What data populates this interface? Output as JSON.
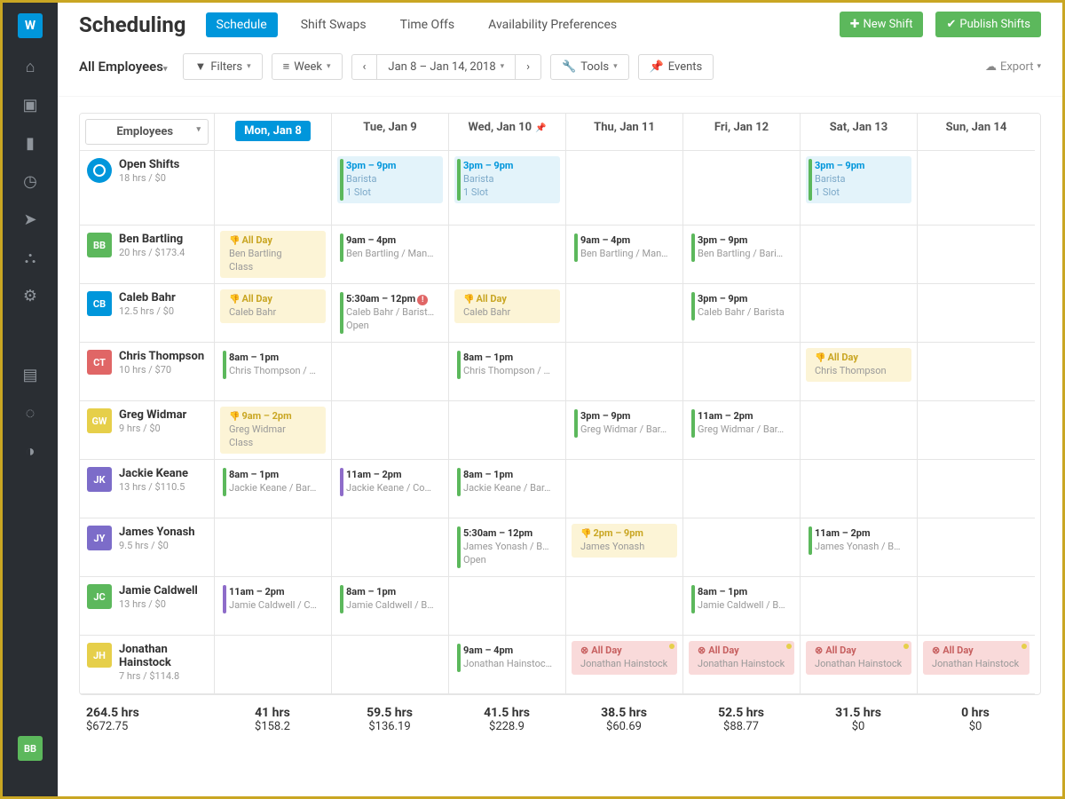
{
  "sidebar": {
    "logo": "W",
    "user": "BB"
  },
  "header": {
    "title": "Scheduling",
    "tabs": [
      "Schedule",
      "Shift Swaps",
      "Time Offs",
      "Availability Preferences"
    ],
    "new_shift": "New Shift",
    "publish": "Publish Shifts"
  },
  "toolbar": {
    "all": "All Employees",
    "filters": "Filters",
    "week": "Week",
    "range": "Jan 8 – Jan 14, 2018",
    "tools": "Tools",
    "events": "Events",
    "export": "Export"
  },
  "days": [
    "Mon, Jan 8",
    "Tue, Jan 9",
    "Wed, Jan 10",
    "Thu, Jan 11",
    "Fri, Jan 12",
    "Sat, Jan 13",
    "Sun, Jan 14"
  ],
  "emp_select": "Employees",
  "rows": [
    {
      "name": "Open Shifts",
      "sub": "18 hrs / $0",
      "av": "",
      "color": "#0096db",
      "open": true,
      "cells": [
        [],
        [
          {
            "k": "open",
            "t": "3pm – 9pm",
            "s": "Barista",
            "b": "1 Slot"
          }
        ],
        [
          {
            "k": "open",
            "t": "3pm – 9pm",
            "s": "Barista",
            "b": "1 Slot"
          }
        ],
        [],
        [],
        [
          {
            "k": "open",
            "t": "3pm – 9pm",
            "s": "Barista",
            "b": "1 Slot"
          }
        ],
        []
      ]
    },
    {
      "name": "Ben Bartling",
      "sub": "20 hrs / $173.4",
      "av": "BB",
      "color": "#5cb85c",
      "cells": [
        [
          {
            "k": "allday",
            "t": "All Day",
            "s": "Ben Bartling",
            "b": "Class",
            "thumb": true
          }
        ],
        [
          {
            "k": "shift",
            "t": "9am – 4pm",
            "s": "Ben Bartling / Man…"
          }
        ],
        [],
        [
          {
            "k": "shift",
            "t": "9am – 4pm",
            "s": "Ben Bartling / Man…"
          }
        ],
        [
          {
            "k": "shift",
            "t": "3pm – 9pm",
            "s": "Ben Bartling / Bari…"
          }
        ],
        [],
        []
      ]
    },
    {
      "name": "Caleb Bahr",
      "sub": "12.5 hrs / $0",
      "av": "CB",
      "color": "#0096db",
      "cells": [
        [
          {
            "k": "allday",
            "t": "All Day",
            "s": "Caleb Bahr",
            "thumb": true
          }
        ],
        [
          {
            "k": "shift",
            "t": "5:30am – 12pm",
            "s": "Caleb Bahr / Barist…",
            "b": "Open",
            "alert": true
          }
        ],
        [
          {
            "k": "allday",
            "t": "All Day",
            "s": "Caleb Bahr",
            "thumb": true
          }
        ],
        [],
        [
          {
            "k": "shift",
            "t": "3pm – 9pm",
            "s": "Caleb Bahr / Barista"
          }
        ],
        [],
        []
      ]
    },
    {
      "name": "Chris Thompson",
      "sub": "10 hrs / $70",
      "av": "CT",
      "color": "#e06666",
      "cells": [
        [
          {
            "k": "shift",
            "t": "8am – 1pm",
            "s": "Chris Thompson / …"
          }
        ],
        [],
        [
          {
            "k": "shift",
            "t": "8am – 1pm",
            "s": "Chris Thompson / …"
          }
        ],
        [],
        [],
        [
          {
            "k": "allday",
            "t": "All Day",
            "s": "Chris Thompson",
            "thumb": true
          }
        ],
        []
      ]
    },
    {
      "name": "Greg Widmar",
      "sub": "9 hrs / $0",
      "av": "GW",
      "color": "#e6cf4a",
      "cells": [
        [
          {
            "k": "allday",
            "t": "9am – 2pm",
            "s": "Greg Widmar",
            "b": "Class",
            "thumb": true
          }
        ],
        [],
        [],
        [
          {
            "k": "shift",
            "t": "3pm – 9pm",
            "s": "Greg Widmar / Bar…"
          }
        ],
        [
          {
            "k": "shift",
            "t": "11am – 2pm",
            "s": "Greg Widmar / Bar…"
          }
        ],
        [],
        []
      ]
    },
    {
      "name": "Jackie Keane",
      "sub": "13 hrs / $110.5",
      "av": "JK",
      "color": "#7c6cc9",
      "cells": [
        [
          {
            "k": "shift",
            "t": "8am – 1pm",
            "s": "Jackie Keane / Bar…"
          }
        ],
        [
          {
            "k": "shift",
            "t": "11am – 2pm",
            "s": "Jackie Keane / Co…",
            "purple": true
          }
        ],
        [
          {
            "k": "shift",
            "t": "8am – 1pm",
            "s": "Jackie Keane / Bar…"
          }
        ],
        [],
        [],
        [],
        []
      ]
    },
    {
      "name": "James Yonash",
      "sub": "9.5 hrs / $0",
      "av": "JY",
      "color": "#7c6cc9",
      "cells": [
        [],
        [],
        [
          {
            "k": "shift",
            "t": "5:30am – 12pm",
            "s": "James Yonash / B…",
            "b": "Open"
          }
        ],
        [
          {
            "k": "allday",
            "t": "2pm – 9pm",
            "s": "James Yonash",
            "thumb": true
          }
        ],
        [],
        [
          {
            "k": "shift",
            "t": "11am – 2pm",
            "s": "James Yonash / B…"
          }
        ],
        []
      ]
    },
    {
      "name": "Jamie Caldwell",
      "sub": "13 hrs / $0",
      "av": "JC",
      "color": "#5cb85c",
      "cells": [
        [
          {
            "k": "shift",
            "t": "11am – 2pm",
            "s": "Jamie Caldwell / C…",
            "purple": true
          }
        ],
        [
          {
            "k": "shift",
            "t": "8am – 1pm",
            "s": "Jamie Caldwell / B…"
          }
        ],
        [],
        [],
        [
          {
            "k": "shift",
            "t": "8am – 1pm",
            "s": "Jamie Caldwell / B…"
          }
        ],
        [],
        []
      ]
    },
    {
      "name": "Jonathan Hainstock",
      "sub": "7 hrs / $114.8",
      "av": "JH",
      "color": "#e6cf4a",
      "cells": [
        [],
        [],
        [
          {
            "k": "shift",
            "t": "9am – 4pm",
            "s": "Jonathan Hainstoc…"
          }
        ],
        [
          {
            "k": "off",
            "t": "All Day",
            "s": "Jonathan Hainstock",
            "dot": true
          }
        ],
        [
          {
            "k": "off",
            "t": "All Day",
            "s": "Jonathan Hainstock",
            "dot": true
          }
        ],
        [
          {
            "k": "off",
            "t": "All Day",
            "s": "Jonathan Hainstock",
            "dot": true
          }
        ],
        [
          {
            "k": "off",
            "t": "All Day",
            "s": "Jonathan Hainstock",
            "dot": true
          }
        ]
      ]
    }
  ],
  "footer": [
    {
      "h": "264.5 hrs",
      "d": "$672.75"
    },
    {
      "h": "41 hrs",
      "d": "$158.2"
    },
    {
      "h": "59.5 hrs",
      "d": "$136.19"
    },
    {
      "h": "41.5 hrs",
      "d": "$228.9"
    },
    {
      "h": "38.5 hrs",
      "d": "$60.69"
    },
    {
      "h": "52.5 hrs",
      "d": "$88.77"
    },
    {
      "h": "31.5 hrs",
      "d": "$0"
    },
    {
      "h": "0 hrs",
      "d": "$0"
    }
  ]
}
